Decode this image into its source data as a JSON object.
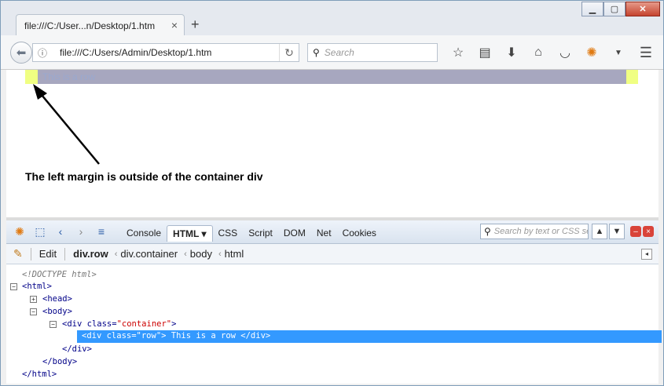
{
  "window": {
    "controls": [
      "minimize",
      "maximize",
      "close"
    ]
  },
  "tab": {
    "title": "file:///C:/User...n/Desktop/1.htm",
    "close_glyph": "×",
    "new_tab_glyph": "+"
  },
  "nav": {
    "url": "file:///C:/Users/Admin/Desktop/1.htm",
    "search_placeholder": "Search"
  },
  "page": {
    "row_text": "This is a row",
    "annotation": "The left margin is outside of the container div",
    "colors": {
      "container": "#f0ff82",
      "row": "#a7a7bf"
    }
  },
  "firebug": {
    "tabs": [
      {
        "label": "Console"
      },
      {
        "label": "HTML ▾",
        "active": true
      },
      {
        "label": "CSS"
      },
      {
        "label": "Script"
      },
      {
        "label": "DOM"
      },
      {
        "label": "Net"
      },
      {
        "label": "Cookies"
      }
    ],
    "search_placeholder": "Search by text or CSS se",
    "edit_label": "Edit",
    "breadcrumbs": [
      "div.row",
      "div.container",
      "body",
      "html"
    ],
    "tree": {
      "doctype": "<!DOCTYPE html>",
      "html_open": "<html>",
      "head": "<head>",
      "body_open": "<body>",
      "container_open_tag": "<div",
      "container_attr": "class=",
      "container_val": "\"container\"",
      "container_close_bracket": ">",
      "row_line": "<div class=\"row\"> This is a row </div>",
      "div_close": "</div>",
      "body_close": "</body>",
      "html_close": "</html>"
    }
  }
}
